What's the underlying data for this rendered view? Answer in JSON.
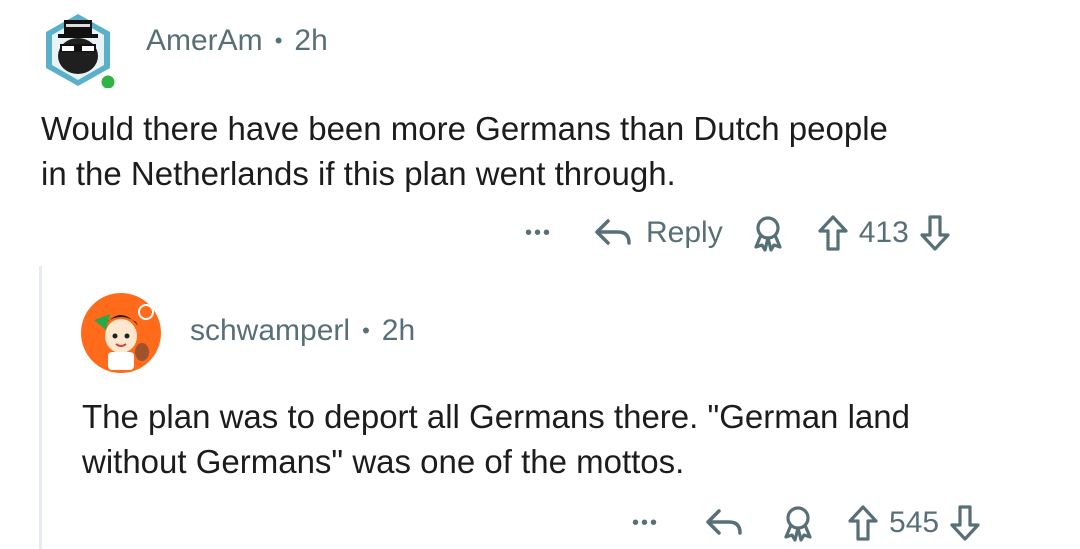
{
  "comments": [
    {
      "author": "AmerAm",
      "separator": "•",
      "time": "2h",
      "text_line1": "Would there have been more Germans than Dutch people",
      "text_line2": "in the Netherlands if this plan went through.",
      "more": "•••",
      "reply_label": "Reply",
      "score": "413"
    },
    {
      "author": "schwamperl",
      "separator": "•",
      "time": "2h",
      "text_line1": "The plan was to deport all Germans there. \"German land",
      "text_line2": "without Germans\" was one of the mottos.",
      "more": "•••",
      "score": "545"
    }
  ],
  "colors": {
    "meta": "#576f76",
    "online": "#2fb344",
    "avatar_bg": "#5ab0c8",
    "avatar2_bg": "#ff6b1a"
  }
}
